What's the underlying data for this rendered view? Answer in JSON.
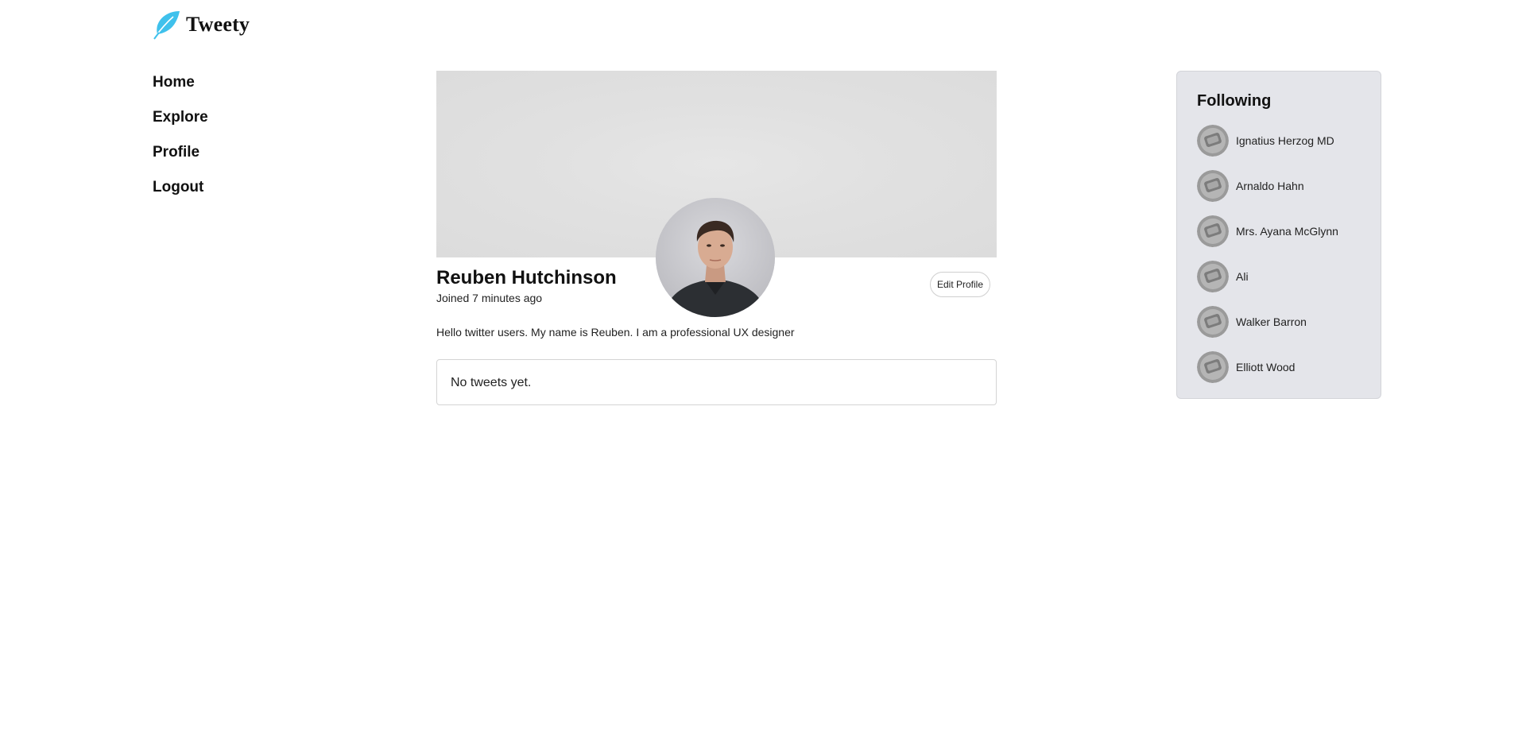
{
  "app": {
    "logo_text": "Tweety",
    "brand_color": "#3fc1ec",
    "logo_icon": "feather-icon"
  },
  "nav": {
    "items": [
      {
        "label": "Home"
      },
      {
        "label": "Explore"
      },
      {
        "label": "Profile"
      },
      {
        "label": "Logout"
      }
    ]
  },
  "profile": {
    "name": "Reuben Hutchinson",
    "joined": "Joined 7 minutes ago",
    "edit_label": "Edit Profile",
    "bio": "Hello twitter users. My name is Reuben. I am a professional UX designer",
    "tweets_empty": "No tweets yet."
  },
  "following": {
    "title": "Following",
    "users": [
      {
        "name": "Ignatius Herzog MD"
      },
      {
        "name": "Arnaldo Hahn"
      },
      {
        "name": "Mrs. Ayana McGlynn"
      },
      {
        "name": "Ali"
      },
      {
        "name": "Walker Barron"
      },
      {
        "name": "Elliott Wood"
      }
    ]
  }
}
